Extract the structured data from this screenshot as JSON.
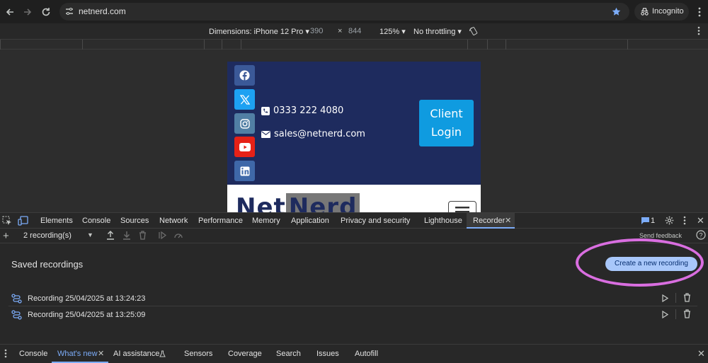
{
  "browser": {
    "url": "netnerd.com",
    "incognito_label": "Incognito"
  },
  "device_toolbar": {
    "dimensions_label": "Dimensions: iPhone 12 Pro",
    "width": "390",
    "times": "×",
    "height": "844",
    "zoom": "125%",
    "throttling": "No throttling"
  },
  "site": {
    "phone": "0333 222 4080",
    "email": "sales@netnerd.com",
    "client_login_line1": "Client",
    "client_login_line2": "Login",
    "logo_part1": "Net",
    "logo_part2": "Nerd"
  },
  "devtools": {
    "tabs": [
      "Elements",
      "Console",
      "Sources",
      "Network",
      "Performance",
      "Memory",
      "Application",
      "Privacy and security",
      "Lighthouse",
      "Recorder"
    ],
    "issues_badge": "1",
    "recordings_select": "2 recording(s)",
    "feedback_link": "Send feedback",
    "saved_recordings_title": "Saved recordings",
    "create_button": "Create a new recording",
    "recordings": [
      {
        "name": "Recording 25/04/2025 at 13:24:23"
      },
      {
        "name": "Recording 25/04/2025 at 13:25:09"
      }
    ]
  },
  "drawer": {
    "tabs": [
      "Console",
      "What's new",
      "AI assistance",
      "Sensors",
      "Coverage",
      "Search",
      "Issues",
      "Autofill"
    ]
  },
  "colors": {
    "site_header": "#1e2b5e",
    "client_button": "#0f9be0",
    "create_button": "#a8c7fa",
    "highlight_ring": "#d96ee0",
    "facebook": "#3b5998",
    "twitter": "#1da1f2",
    "instagram": "#517fa4",
    "youtube": "#e62117",
    "linkedin": "#3f68a8"
  }
}
